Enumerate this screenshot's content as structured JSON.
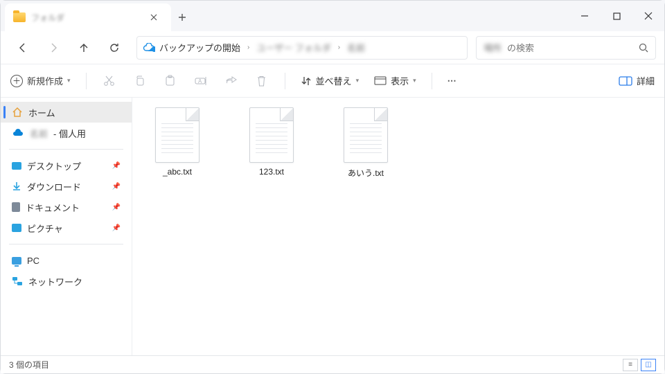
{
  "titlebar": {
    "tab_title": "フォルダ"
  },
  "addressbar": {
    "backup_label": "バックアップの開始",
    "crumb1": "ユーザー フォルダ",
    "crumb2": "名前"
  },
  "search": {
    "scope_blur": "場所",
    "suffix": "の検索"
  },
  "toolbar": {
    "new_label": "新規作成",
    "sort_label": "並べ替え",
    "view_label": "表示",
    "details_label": "詳細"
  },
  "sidebar": {
    "home": "ホーム",
    "onedrive_blur": "名前",
    "onedrive_suffix": " - 個人用",
    "desktop": "デスクトップ",
    "downloads": "ダウンロード",
    "documents": "ドキュメント",
    "pictures": "ピクチャ",
    "pc": "PC",
    "network": "ネットワーク"
  },
  "files": [
    {
      "name": "_abc.txt"
    },
    {
      "name": "123.txt"
    },
    {
      "name": "あいう.txt"
    }
  ],
  "status": {
    "count": "3 個の項目"
  }
}
